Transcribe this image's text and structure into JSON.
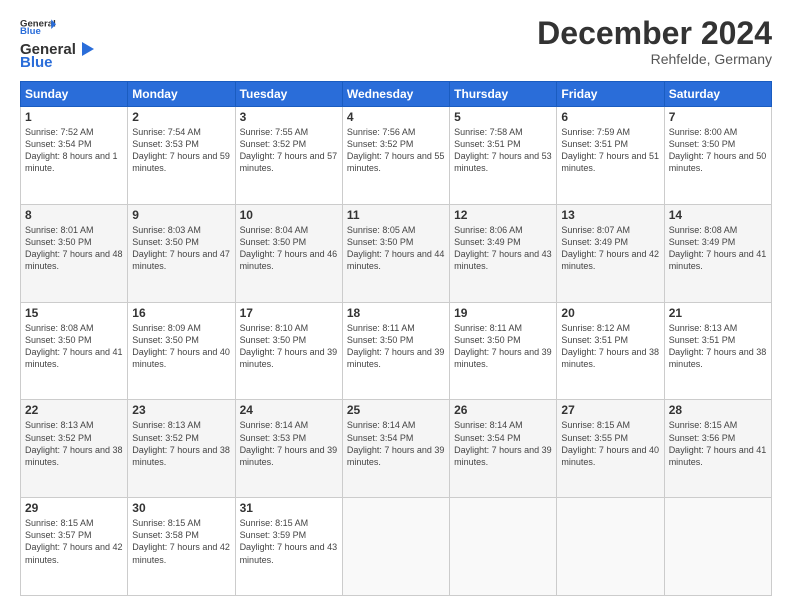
{
  "header": {
    "logo_line1": "General",
    "logo_line2": "Blue",
    "month": "December 2024",
    "location": "Rehfelde, Germany"
  },
  "days_of_week": [
    "Sunday",
    "Monday",
    "Tuesday",
    "Wednesday",
    "Thursday",
    "Friday",
    "Saturday"
  ],
  "weeks": [
    [
      {
        "day": "1",
        "sunrise": "7:52 AM",
        "sunset": "3:54 PM",
        "daylight": "8 hours and 1 minute."
      },
      {
        "day": "2",
        "sunrise": "7:54 AM",
        "sunset": "3:53 PM",
        "daylight": "7 hours and 59 minutes."
      },
      {
        "day": "3",
        "sunrise": "7:55 AM",
        "sunset": "3:52 PM",
        "daylight": "7 hours and 57 minutes."
      },
      {
        "day": "4",
        "sunrise": "7:56 AM",
        "sunset": "3:52 PM",
        "daylight": "7 hours and 55 minutes."
      },
      {
        "day": "5",
        "sunrise": "7:58 AM",
        "sunset": "3:51 PM",
        "daylight": "7 hours and 53 minutes."
      },
      {
        "day": "6",
        "sunrise": "7:59 AM",
        "sunset": "3:51 PM",
        "daylight": "7 hours and 51 minutes."
      },
      {
        "day": "7",
        "sunrise": "8:00 AM",
        "sunset": "3:50 PM",
        "daylight": "7 hours and 50 minutes."
      }
    ],
    [
      {
        "day": "8",
        "sunrise": "8:01 AM",
        "sunset": "3:50 PM",
        "daylight": "7 hours and 48 minutes."
      },
      {
        "day": "9",
        "sunrise": "8:03 AM",
        "sunset": "3:50 PM",
        "daylight": "7 hours and 47 minutes."
      },
      {
        "day": "10",
        "sunrise": "8:04 AM",
        "sunset": "3:50 PM",
        "daylight": "7 hours and 46 minutes."
      },
      {
        "day": "11",
        "sunrise": "8:05 AM",
        "sunset": "3:50 PM",
        "daylight": "7 hours and 44 minutes."
      },
      {
        "day": "12",
        "sunrise": "8:06 AM",
        "sunset": "3:49 PM",
        "daylight": "7 hours and 43 minutes."
      },
      {
        "day": "13",
        "sunrise": "8:07 AM",
        "sunset": "3:49 PM",
        "daylight": "7 hours and 42 minutes."
      },
      {
        "day": "14",
        "sunrise": "8:08 AM",
        "sunset": "3:49 PM",
        "daylight": "7 hours and 41 minutes."
      }
    ],
    [
      {
        "day": "15",
        "sunrise": "8:08 AM",
        "sunset": "3:50 PM",
        "daylight": "7 hours and 41 minutes."
      },
      {
        "day": "16",
        "sunrise": "8:09 AM",
        "sunset": "3:50 PM",
        "daylight": "7 hours and 40 minutes."
      },
      {
        "day": "17",
        "sunrise": "8:10 AM",
        "sunset": "3:50 PM",
        "daylight": "7 hours and 39 minutes."
      },
      {
        "day": "18",
        "sunrise": "8:11 AM",
        "sunset": "3:50 PM",
        "daylight": "7 hours and 39 minutes."
      },
      {
        "day": "19",
        "sunrise": "8:11 AM",
        "sunset": "3:50 PM",
        "daylight": "7 hours and 39 minutes."
      },
      {
        "day": "20",
        "sunrise": "8:12 AM",
        "sunset": "3:51 PM",
        "daylight": "7 hours and 38 minutes."
      },
      {
        "day": "21",
        "sunrise": "8:13 AM",
        "sunset": "3:51 PM",
        "daylight": "7 hours and 38 minutes."
      }
    ],
    [
      {
        "day": "22",
        "sunrise": "8:13 AM",
        "sunset": "3:52 PM",
        "daylight": "7 hours and 38 minutes."
      },
      {
        "day": "23",
        "sunrise": "8:13 AM",
        "sunset": "3:52 PM",
        "daylight": "7 hours and 38 minutes."
      },
      {
        "day": "24",
        "sunrise": "8:14 AM",
        "sunset": "3:53 PM",
        "daylight": "7 hours and 39 minutes."
      },
      {
        "day": "25",
        "sunrise": "8:14 AM",
        "sunset": "3:54 PM",
        "daylight": "7 hours and 39 minutes."
      },
      {
        "day": "26",
        "sunrise": "8:14 AM",
        "sunset": "3:54 PM",
        "daylight": "7 hours and 39 minutes."
      },
      {
        "day": "27",
        "sunrise": "8:15 AM",
        "sunset": "3:55 PM",
        "daylight": "7 hours and 40 minutes."
      },
      {
        "day": "28",
        "sunrise": "8:15 AM",
        "sunset": "3:56 PM",
        "daylight": "7 hours and 41 minutes."
      }
    ],
    [
      {
        "day": "29",
        "sunrise": "8:15 AM",
        "sunset": "3:57 PM",
        "daylight": "7 hours and 42 minutes."
      },
      {
        "day": "30",
        "sunrise": "8:15 AM",
        "sunset": "3:58 PM",
        "daylight": "7 hours and 42 minutes."
      },
      {
        "day": "31",
        "sunrise": "8:15 AM",
        "sunset": "3:59 PM",
        "daylight": "7 hours and 43 minutes."
      },
      null,
      null,
      null,
      null
    ]
  ]
}
